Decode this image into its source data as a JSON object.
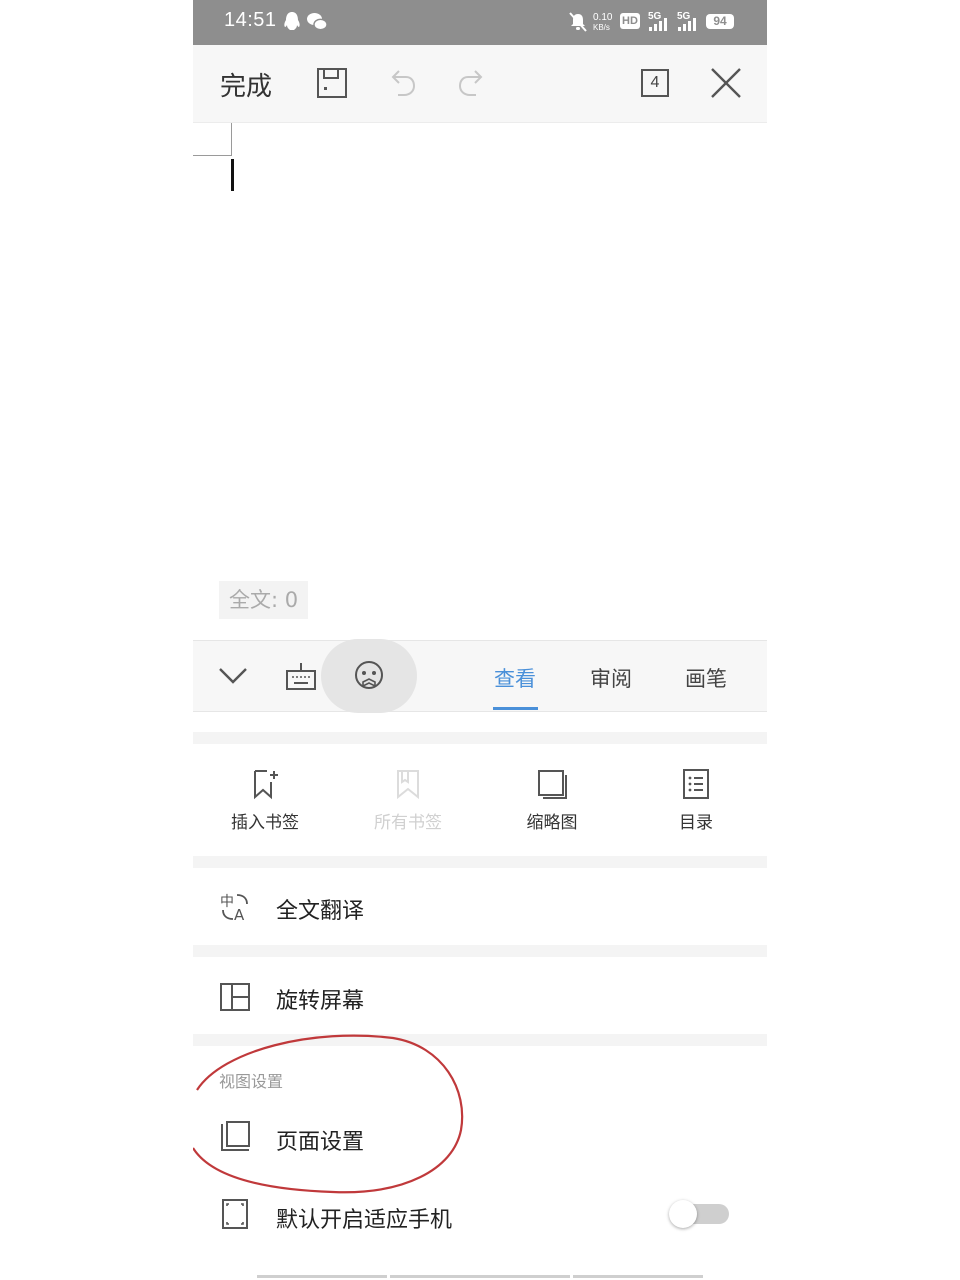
{
  "status_bar": {
    "time": "14:51",
    "net_speed_value": "0.10",
    "net_speed_unit": "KB/s",
    "hd_label": "HD",
    "sim1_label": "5G",
    "sim2_label": "5G",
    "battery": "94",
    "icons": [
      "qq-icon",
      "wechat-icon",
      "mute-bell-icon",
      "hd-icon",
      "signal-icon",
      "signal-icon",
      "battery-icon"
    ]
  },
  "toolbar": {
    "done_label": "完成",
    "page_count": "4",
    "icons": [
      "save-icon",
      "undo-icon",
      "redo-icon",
      "page-count-icon",
      "close-icon"
    ]
  },
  "document": {
    "word_count": "全文: 0"
  },
  "tabbar": {
    "icons": [
      "collapse-chevron-icon",
      "keyboard-icon",
      "assistant-face-icon"
    ],
    "tabs": [
      {
        "label": "查看",
        "active": true
      },
      {
        "label": "审阅",
        "active": false
      },
      {
        "label": "画笔",
        "active": false
      }
    ],
    "accent_color": "#4a90d9"
  },
  "tools": [
    {
      "label": "插入书签",
      "icon": "bookmark-add-icon",
      "enabled": true
    },
    {
      "label": "所有书签",
      "icon": "bookmarks-icon",
      "enabled": false
    },
    {
      "label": "缩略图",
      "icon": "thumbnail-icon",
      "enabled": true
    },
    {
      "label": "目录",
      "icon": "toc-icon",
      "enabled": true
    }
  ],
  "rows": {
    "translate": "全文翻译",
    "rotate": "旋转屏幕",
    "section_view": "视图设置",
    "page_setup": "页面设置",
    "fit_phone": "默认开启适应手机",
    "fit_phone_toggle": false
  },
  "annotation_color": "#c0393b"
}
